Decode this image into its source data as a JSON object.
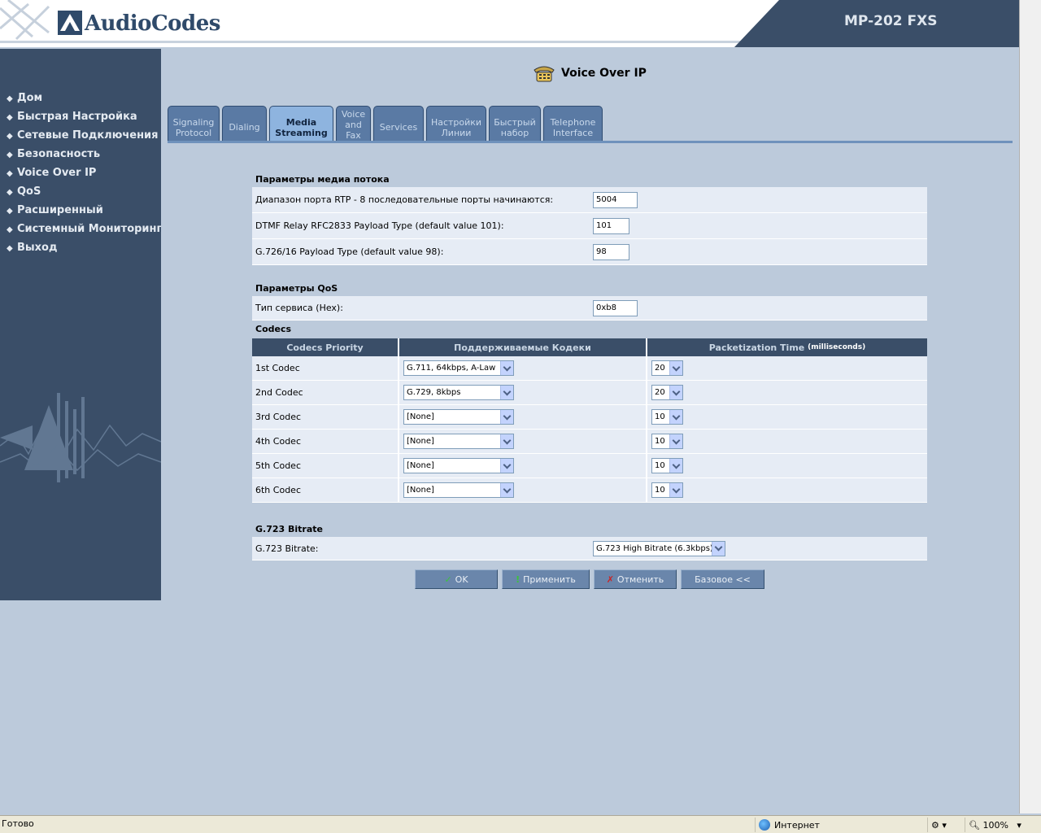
{
  "header": {
    "brand": "AudioCodes",
    "model": "MP-202 FXS"
  },
  "sidebar": {
    "items": [
      {
        "label": "Дом"
      },
      {
        "label": "Быстрая Настройка"
      },
      {
        "label": "Сетевые Подключения"
      },
      {
        "label": "Безопасность"
      },
      {
        "label": "Voice Over IP"
      },
      {
        "label": "QoS"
      },
      {
        "label": "Расширенный"
      },
      {
        "label": "Системный Мониторинг"
      },
      {
        "label": "Выход"
      }
    ]
  },
  "page": {
    "title": "Voice Over IP",
    "icon": "phone-icon"
  },
  "tabs": [
    {
      "line1": "Signaling",
      "line2": "Protocol"
    },
    {
      "line1": "Dialing",
      "line2": ""
    },
    {
      "line1": "Media",
      "line2": "Streaming"
    },
    {
      "line1": "Voice",
      "line2": "and",
      "line3": "Fax"
    },
    {
      "line1": "Services",
      "line2": ""
    },
    {
      "line1": "Настройки",
      "line2": "Линии"
    },
    {
      "line1": "Быстрый",
      "line2": "набор"
    },
    {
      "line1": "Telephone",
      "line2": "Interface"
    }
  ],
  "media": {
    "section_title": "Параметры медиа потока",
    "rows": [
      {
        "label": "Диапазон порта RTP - 8 последовательные порты начинаются:",
        "value": "5004"
      },
      {
        "label": "DTMF Relay RFC2833 Payload Type (default value 101):",
        "value": "101"
      },
      {
        "label": "G.726/16 Payload Type (default value 98):",
        "value": "98"
      }
    ]
  },
  "qos": {
    "section_title": "Параметры QoS",
    "label": "Тип сервиса (Hex):",
    "value": "0xb8"
  },
  "codecs": {
    "section_title": "Codecs",
    "headers": {
      "priority": "Codecs Priority",
      "supported": "Поддерживаемые Кодеки",
      "ptime": "Packetization Time",
      "ptime_unit": "(milliseconds)"
    },
    "rows": [
      {
        "priority": "1st Codec",
        "codec": "G.711, 64kbps, A-Law",
        "ptime": "20"
      },
      {
        "priority": "2nd Codec",
        "codec": "G.729, 8kbps",
        "ptime": "20"
      },
      {
        "priority": "3rd Codec",
        "codec": "[None]",
        "ptime": "10"
      },
      {
        "priority": "4th Codec",
        "codec": "[None]",
        "ptime": "10"
      },
      {
        "priority": "5th Codec",
        "codec": "[None]",
        "ptime": "10"
      },
      {
        "priority": "6th Codec",
        "codec": "[None]",
        "ptime": "10"
      }
    ]
  },
  "g723": {
    "section_title": "G.723 Bitrate",
    "label": "G.723 Bitrate:",
    "value": "G.723 High Bitrate (6.3kbps)"
  },
  "buttons": {
    "ok": "OK",
    "apply": "Применить",
    "cancel": "Отменить",
    "basic": "Базовое <<"
  },
  "statusbar": {
    "status": "Готово",
    "zone": "Интернет",
    "zoom": "100%"
  },
  "colors": {
    "background": "#bccadb",
    "sidebar": "#3a4e68",
    "tab": "#5a7aa4",
    "tab_active": "#8eb4df"
  }
}
